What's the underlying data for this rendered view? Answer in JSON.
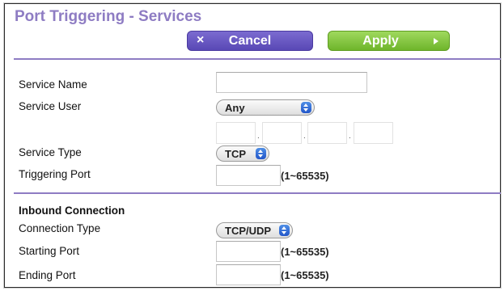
{
  "page": {
    "title": "Port Triggering - Services"
  },
  "toolbar": {
    "cancel_label": "Cancel",
    "cancel_icon": "×",
    "apply_label": "Apply"
  },
  "form": {
    "service_name": {
      "label": "Service Name",
      "value": ""
    },
    "service_user": {
      "label": "Service User",
      "selected": "Any",
      "ip_octets": [
        "",
        "",
        "",
        ""
      ]
    },
    "service_type": {
      "label": "Service Type",
      "selected": "TCP"
    },
    "triggering_port": {
      "label": "Triggering Port",
      "value": "",
      "range": "(1~65535)"
    }
  },
  "inbound": {
    "section_title": "Inbound Connection",
    "connection_type": {
      "label": "Connection Type",
      "selected": "TCP/UDP"
    },
    "starting_port": {
      "label": "Starting Port",
      "value": "",
      "range": "(1~65535)"
    },
    "ending_port": {
      "label": "Ending Port",
      "value": "",
      "range": "(1~65535)"
    }
  },
  "colors": {
    "title": "#8e7cc3",
    "divider": "#8e7cc3",
    "cancel_button": "#6a5acd",
    "apply_button": "#84c443",
    "select_arrow": "#2f6fd9"
  }
}
